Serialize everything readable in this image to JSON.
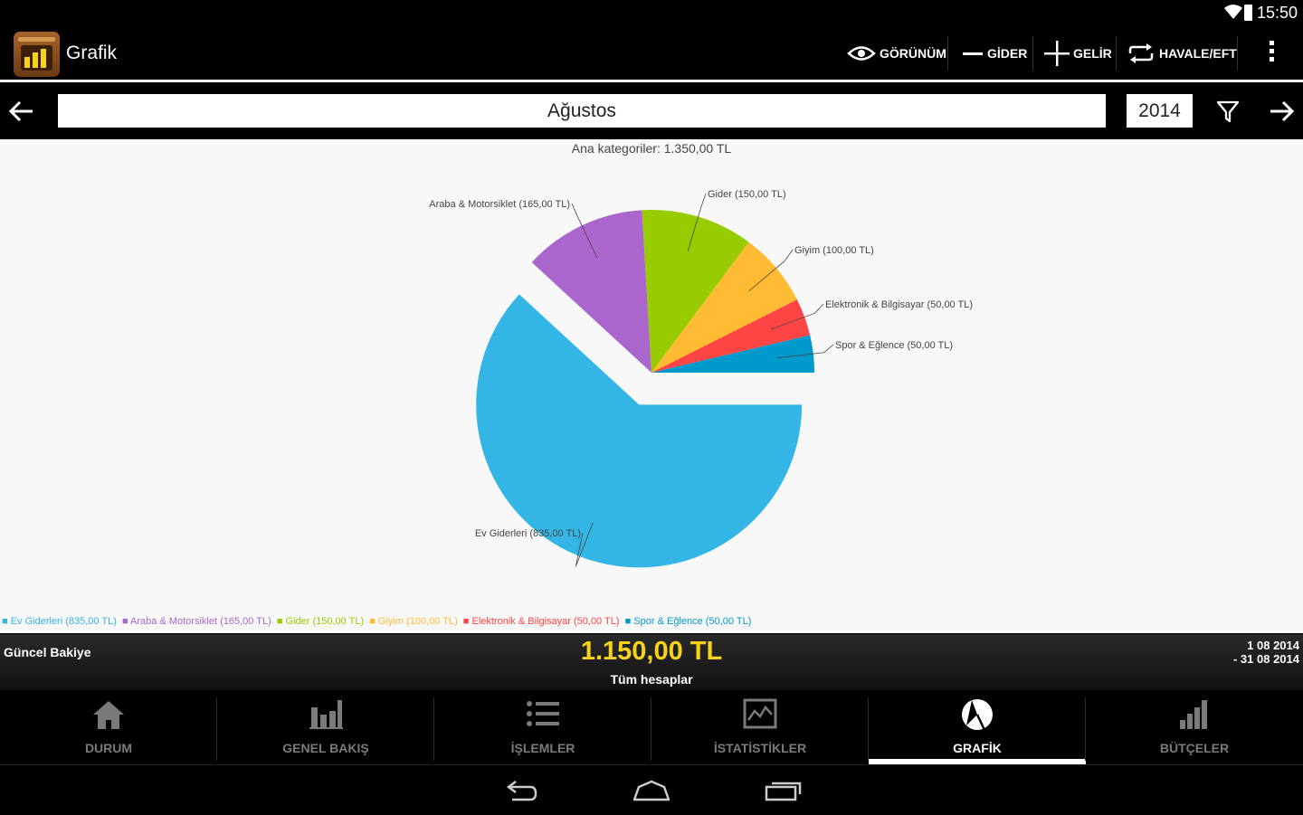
{
  "status_bar": {
    "time": "15:50"
  },
  "action_bar": {
    "title": "Grafik",
    "actions": [
      {
        "label": "GÖRÜNÜM",
        "icon": "eye-icon"
      },
      {
        "label": "GİDER",
        "icon": "minus-icon"
      },
      {
        "label": "GELİR",
        "icon": "plus-icon"
      },
      {
        "label": "HAVALE/EFT",
        "icon": "transfer-icon"
      }
    ]
  },
  "period": {
    "month": "Ağustos",
    "year": "2014"
  },
  "chart_data": {
    "type": "pie",
    "title": "Ana kategoriler: 1.350,00 TL",
    "slices": [
      {
        "label": "Ev Giderleri (835,00 TL)",
        "value": 835,
        "color": "#33b5e5"
      },
      {
        "label": "Araba & Motorsiklet (165,00 TL)",
        "value": 165,
        "color": "#aa66cc"
      },
      {
        "label": "Gider (150,00 TL)",
        "value": 150,
        "color": "#99cc00"
      },
      {
        "label": "Giyim (100,00 TL)",
        "value": 100,
        "color": "#ffbb33"
      },
      {
        "label": "Elektronik & Bilgisayar (50,00 TL)",
        "value": 50,
        "color": "#ff4444"
      },
      {
        "label": "Spor & Eğlence (50,00 TL)",
        "value": 50,
        "color": "#0099cc"
      }
    ],
    "legend_position": "bottom"
  },
  "balance": {
    "label": "Güncel Bakiye",
    "amount": "1.150,00 TL",
    "accounts": "Tüm hesaplar",
    "date_from": "1 08 2014",
    "date_to": "- 31 08 2014"
  },
  "tabs": [
    {
      "label": "DURUM",
      "icon": "home-icon"
    },
    {
      "label": "GENEL BAKIŞ",
      "icon": "bar-chart-icon"
    },
    {
      "label": "İŞLEMLER",
      "icon": "list-icon"
    },
    {
      "label": "İSTATİSTİKLER",
      "icon": "line-chart-icon"
    },
    {
      "label": "GRAFİK",
      "icon": "pie-chart-icon",
      "active": true
    },
    {
      "label": "BÜTÇELER",
      "icon": "budget-bars-icon"
    }
  ],
  "colors": {
    "accent": "#f7d21a",
    "chart_bg": "#f8f8f8"
  }
}
